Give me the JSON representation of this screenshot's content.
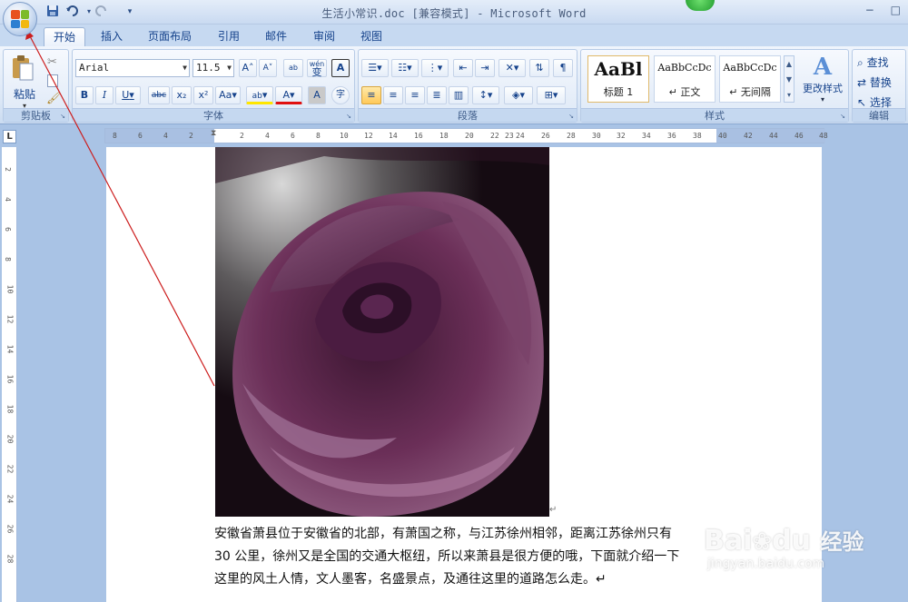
{
  "window": {
    "title": "生活小常识.doc [兼容模式] - Microsoft Word",
    "min_label": "−",
    "max_label": "□"
  },
  "qat": {
    "save_icon": "save-icon",
    "undo_icon": "undo-icon",
    "redo_icon": "redo-icon"
  },
  "tabs": [
    "开始",
    "插入",
    "页面布局",
    "引用",
    "邮件",
    "审阅",
    "视图"
  ],
  "ribbon": {
    "clipboard": {
      "paste_label": "粘贴",
      "group_label": "剪贴板"
    },
    "font": {
      "group_label": "字体",
      "font_name": "Arial",
      "font_size": "11.5",
      "wen": "wén",
      "change_case_char": "变",
      "big_a": "A",
      "bold": "B",
      "italic": "I",
      "underline": "U",
      "strike": "abc",
      "sub": "x₂",
      "sup": "x²",
      "aa": "Aa",
      "ab": "ab",
      "char_shade": "A",
      "enclose": "字"
    },
    "paragraph": {
      "group_label": "段落"
    },
    "styles": {
      "group_label": "样式",
      "items": [
        {
          "sample": "AaBl",
          "name": "标题 1"
        },
        {
          "sample": "AaBbCcDc",
          "name": "↵ 正文"
        },
        {
          "sample": "AaBbCcDc",
          "name": "↵ 无间隔"
        }
      ],
      "change_styles": "更改样式"
    },
    "editing": {
      "group_label": "编辑",
      "find": "查找",
      "replace": "替换",
      "select": "选择"
    }
  },
  "ruler": {
    "h_ticks": [
      "8",
      "6",
      "4",
      "2",
      "2",
      "4",
      "6",
      "8",
      "10",
      "12",
      "14",
      "16",
      "18",
      "20",
      "22",
      "23",
      "24",
      "26",
      "28",
      "30",
      "32",
      "34",
      "36",
      "38",
      "40",
      "42",
      "44",
      "46",
      "48"
    ],
    "v_ticks": [
      "2",
      "4",
      "6",
      "8",
      "10",
      "12",
      "14",
      "16",
      "18",
      "20",
      "22",
      "24",
      "26",
      "28"
    ],
    "tab_marker": "L"
  },
  "document": {
    "paragraph_lines": [
      "安徽省萧县位于安徽省的北部，有萧国之称，与江苏徐州相邻，距离江苏徐州只有",
      "30 公里，徐州又是全国的交通大枢纽，所以来萧县是很方便的哦，下面就介绍一下",
      "这里的风土人情，文人墨客，名盛景点，及通往这里的道路怎么走。↵"
    ],
    "image_end_mark": "↵"
  },
  "watermark": {
    "brand": "Bai",
    "brand2": "du",
    "cn": "经验",
    "url": "jingyan.baidu.com"
  },
  "colors": {
    "highlight": "#ffe600",
    "font_color": "#e01010",
    "accent": "#15428b"
  }
}
